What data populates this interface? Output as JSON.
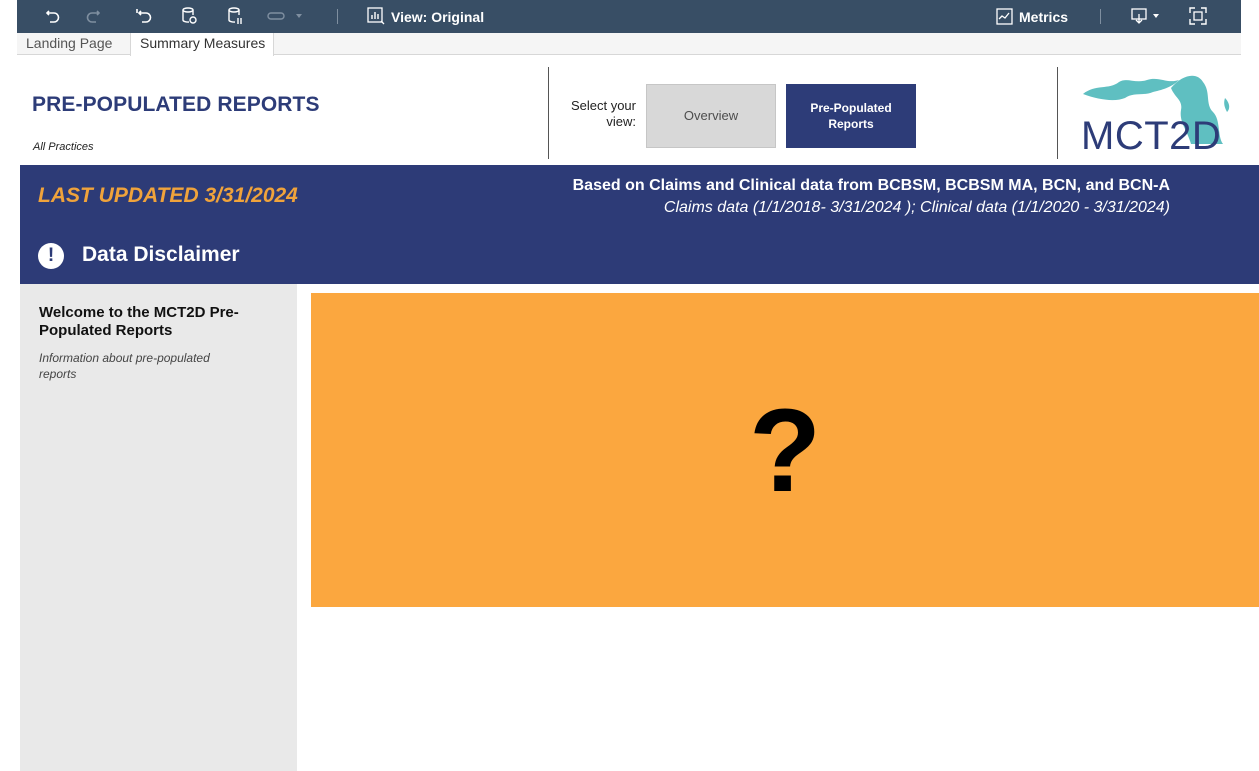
{
  "toolbar": {
    "view_label": "View: Original",
    "metrics_label": "Metrics",
    "icons": [
      "undo-icon",
      "redo-icon",
      "revert-icon",
      "refresh-data-icon",
      "pause-updates-icon",
      "share-icon",
      "view-icon",
      "metrics-icon",
      "download-icon",
      "fullscreen-icon"
    ]
  },
  "tabs": [
    {
      "label": "Landing Page",
      "active": false
    },
    {
      "label": "Summary Measures",
      "active": true
    }
  ],
  "header": {
    "title": "PRE-POPULATED REPORTS",
    "practice": "All Practices",
    "select_view_label": "Select your view:",
    "view_buttons": [
      {
        "label": "Overview",
        "selected": false
      },
      {
        "label": "Pre-Populated Reports",
        "selected": true
      }
    ],
    "logo_text": "MCT2D"
  },
  "banner": {
    "last_updated": "LAST UPDATED 3/31/2024",
    "based_on": "Based on Claims and Clinical data from BCBSM, BCBSM MA, BCN, and BCN-A",
    "date_ranges": "Claims data  (1/1/2018- 3/31/2024 ); Clinical data (1/1/2020 - 3/31/2024)",
    "disclaimer_icon_glyph": "!",
    "disclaimer_title": "Data Disclaimer"
  },
  "side_panel": {
    "welcome": "Welcome to the MCT2D Pre-Populated Reports",
    "info": "Information about pre-populated reports"
  },
  "main": {
    "placeholder_mark": "?"
  },
  "colors": {
    "toolbar_bg": "#384e65",
    "brand_navy": "#2d3b77",
    "accent_orange": "#f0a33b",
    "placeholder_orange": "#fba73f",
    "panel_gray": "#e9e9e9",
    "logo_teal": "#5fbfc1"
  }
}
